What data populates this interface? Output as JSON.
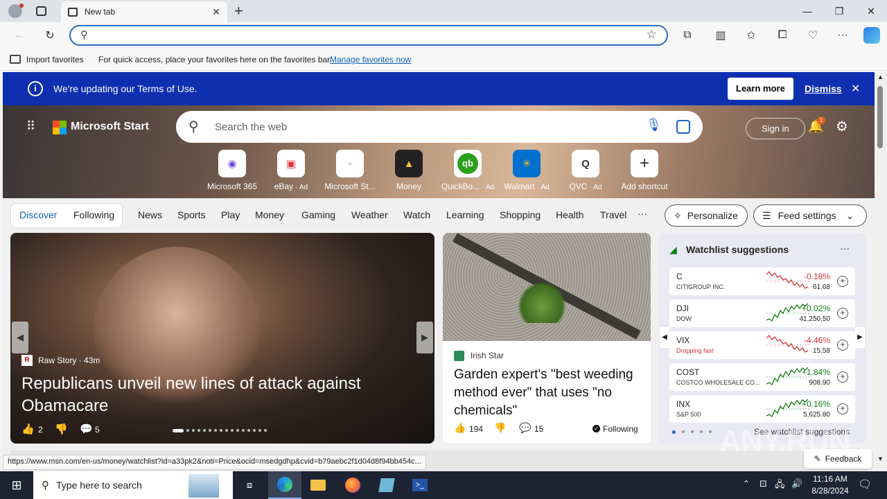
{
  "browser": {
    "tab_title": "New tab",
    "favorites_bar": {
      "import_label": "Import favorites",
      "hint": "For quick access, place your favorites here on the favorites bar.",
      "manage_link": "Manage favorites now"
    },
    "status_url": "https://www.msn.com/en-us/money/watchlist?id=a33pk2&noti=Price&ocid=msedgdhp&cvid=b79aebc2f1d04d8f94bb454c..."
  },
  "banner": {
    "text": "We're updating our Terms of Use.",
    "learn_more": "Learn more",
    "dismiss": "Dismiss"
  },
  "header": {
    "brand": "Microsoft Start",
    "search_placeholder": "Search the web",
    "sign_in": "Sign in",
    "notification_count": "1"
  },
  "quick_links": [
    {
      "label": "Microsoft 365",
      "ad": "",
      "icon": "microsoft-365-icon"
    },
    {
      "label": "eBay",
      "ad": "· Ad",
      "icon": "ebay-icon"
    },
    {
      "label": "Microsoft St...",
      "ad": "",
      "icon": "microsoft-store-icon"
    },
    {
      "label": "Money",
      "ad": "",
      "icon": "money-icon"
    },
    {
      "label": "QuickBo...",
      "ad": "· Ad",
      "icon": "quickbooks-icon"
    },
    {
      "label": "Walmart",
      "ad": "· Ad",
      "icon": "walmart-icon"
    },
    {
      "label": "QVC",
      "ad": "· Ad",
      "icon": "qvc-icon"
    },
    {
      "label": "Add shortcut",
      "ad": "",
      "icon": "plus-icon"
    }
  ],
  "feed_tabs": {
    "discover": "Discover",
    "following": "Following"
  },
  "nav": [
    "News",
    "Sports",
    "Play",
    "Money",
    "Gaming",
    "Weather",
    "Watch",
    "Learning",
    "Shopping",
    "Health",
    "Travel"
  ],
  "nav_more": "···",
  "personalize": "Personalize",
  "feed_settings": "Feed settings",
  "hero_story": {
    "source": "Raw Story · 43m",
    "headline": "Republicans unveil new lines of attack against Obamacare",
    "likes": "2",
    "comments": "5"
  },
  "story2": {
    "source": "Irish Star",
    "headline": "Garden expert's \"best weeding method ever\" that uses \"no chemicals\"",
    "likes": "194",
    "comments": "15",
    "following": "Following"
  },
  "watchlist": {
    "title": "Watchlist suggestions",
    "see_more": "See watchlist suggestions",
    "items": [
      {
        "symbol": "C",
        "name": "CITIGROUP INC.",
        "change": "-0.18%",
        "price": "61.68",
        "trend": "down"
      },
      {
        "symbol": "DJI",
        "name": "DOW",
        "change": "+0.02%",
        "price": "41,250.50",
        "trend": "up"
      },
      {
        "symbol": "VIX",
        "name": "Dropping fast",
        "change": "-4.46%",
        "price": "15.58",
        "trend": "down"
      },
      {
        "symbol": "COST",
        "name": "COSTCO WHOLESALE CO...",
        "change": "+1.84%",
        "price": "908.90",
        "trend": "up"
      },
      {
        "symbol": "INX",
        "name": "S&P 500",
        "change": "+0.16%",
        "price": "5,625.80",
        "trend": "up"
      }
    ]
  },
  "feedback": "Feedback",
  "watermark": "ANY.RUN",
  "taskbar": {
    "search_placeholder": "Type here to search",
    "time": "11:16 AM",
    "date": "8/28/2024"
  },
  "colors": {
    "accent": "#0d2fb0",
    "up": "#107c10",
    "down": "#d13438"
  }
}
